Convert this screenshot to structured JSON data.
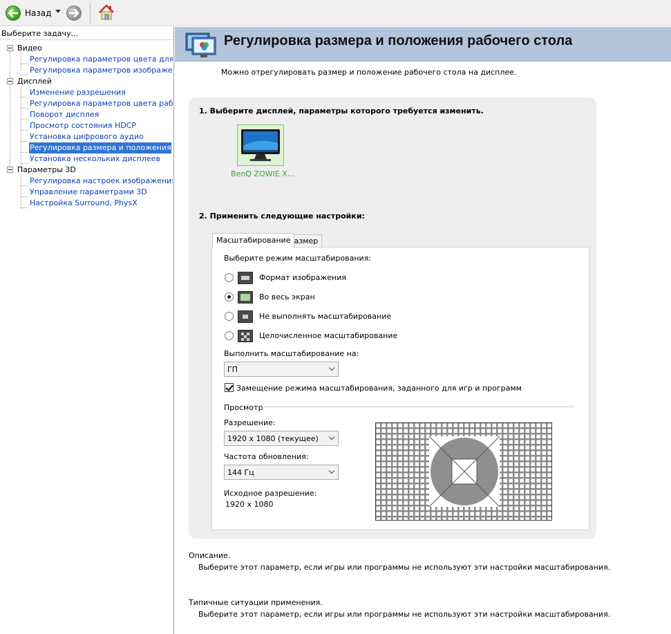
{
  "toolbar": {
    "back_label": "Назад",
    "back_icon": "arrow-left-icon",
    "forward_icon": "arrow-right-icon",
    "home_icon": "home-icon"
  },
  "sidebar": {
    "title": "Выберите задачу...",
    "groups": [
      {
        "label": "Видео",
        "items": [
          "Регулировка параметров цвета для вид",
          "Регулировка параметров изображения д"
        ]
      },
      {
        "label": "Дисплей",
        "items": [
          "Изменение разрешения",
          "Регулировка параметров цвета рабочег",
          "Поворот дисплея",
          "Просмотр состояния HDCP",
          "Установка цифрового аудио",
          "Регулировка размера и положения рабо",
          "Установка нескольких дисплеев"
        ]
      },
      {
        "label": "Параметры 3D",
        "items": [
          "Регулировка настроек изображения с пр",
          "Управление параметрами 3D",
          "Настройка Surround, PhysX"
        ]
      }
    ],
    "selected_item": "Регулировка размера и положения рабо"
  },
  "header": {
    "title": "Регулировка размера и положения рабочего стола"
  },
  "subtitle": "Можно отрегулировать размер и положение рабочего стола на дисплее.",
  "step1": {
    "label": "1. Выберите дисплей, параметры которого требуется изменить.",
    "display_name": "BenQ ZOWIE X..."
  },
  "step2": {
    "label": "2. Применить следующие настройки:",
    "tabs": [
      "Масштабирование",
      "Размер"
    ],
    "active_tab": "Масштабирование",
    "scaling_mode_label": "Выберите режим масштабирования:",
    "modes": [
      {
        "label": "Формат изображения",
        "selected": false
      },
      {
        "label": "Во весь экран",
        "selected": true
      },
      {
        "label": "Не выполнять масштабирование",
        "selected": false
      },
      {
        "label": "Целочисленное масштабирование",
        "selected": false
      }
    ],
    "perform_on_label": "Выполнить масштабирование на:",
    "perform_on_value": "ГП",
    "override_label": "Замещение режима масштабирования, заданного для игр и программ",
    "override_checked": true,
    "preview_label": "Просмотр",
    "resolution_label": "Разрешение:",
    "resolution_value": "1920 x 1080 (текущее)",
    "refresh_label": "Частота обновления:",
    "refresh_value": "144 Гц",
    "native_label": "Исходное разрешение:",
    "native_value": "1920 x 1080"
  },
  "description": {
    "title": "Описание.",
    "body": "Выберите этот параметр, если игры или программы не используют эти настройки масштабирования."
  },
  "typical": {
    "title": "Типичные ситуации применения.",
    "body": "Выберите этот параметр, если игры или программы не используют эти настройки масштабирования."
  },
  "colors": {
    "header_bg": "#b3c5db",
    "selection": "#3074d4",
    "link": "#0b3dc4",
    "display_label": "#38a52c"
  }
}
